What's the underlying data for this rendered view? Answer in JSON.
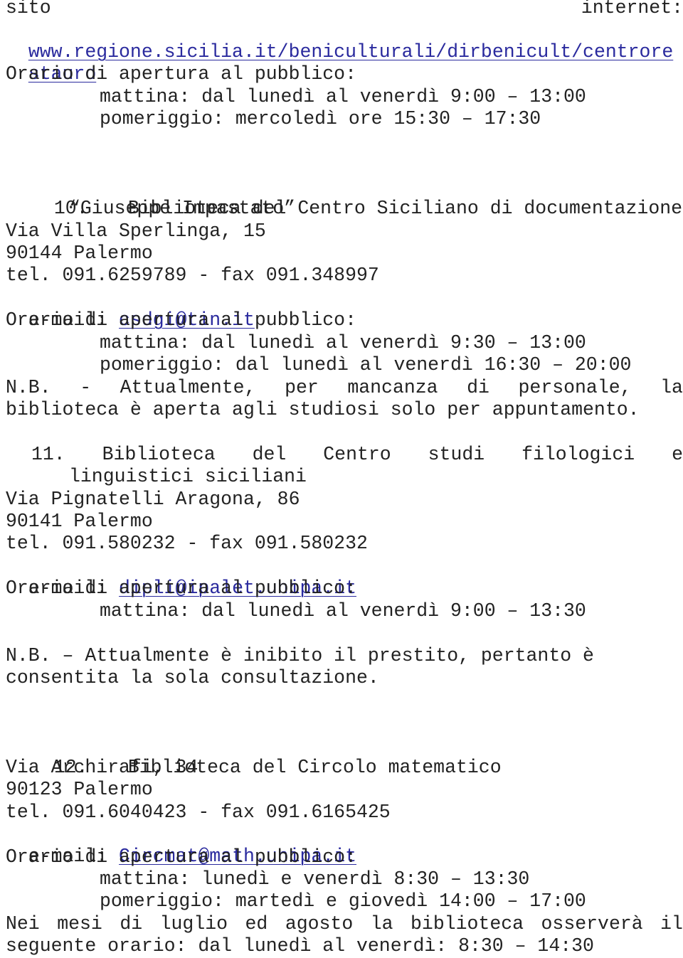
{
  "intro": {
    "site_label_left": "sito",
    "site_label_right": "internet:",
    "url_line1": "www.regione.sicilia.it/beniculturali/dirbenicult/centrore",
    "url_line2": "stauro",
    "hours_heading": "Orario di apertura al pubblico:",
    "hours_morning": "mattina: dal lunedì al venerdì 9:00 – 13:00",
    "hours_afternoon": "pomeriggio: mercoledì ore 15:30 – 17:30"
  },
  "entries": [
    {
      "number": "10.",
      "title_line1": "Biblioteca del Centro Siciliano di documentazione",
      "title_line2": "“Giuseppe Impastato”",
      "address": "Via Villa Sperlinga, 15",
      "city": "90144 Palermo",
      "phone": "tel. 091.6259789 - fax 091.348997",
      "email_label": "e-mail: ",
      "email": "csdgi@tin.it",
      "hours_heading": "Orario di apertura al pubblico:",
      "hours_morning": "mattina: dal lunedì al venerdì 9:30 – 13:00",
      "hours_afternoon": "pomeriggio: dal lunedì al venerdì 16:30 – 20:00",
      "note_line1_words": [
        "N.B.",
        "-",
        "Attualmente,",
        "per",
        "mancanza",
        "di",
        "personale,",
        "la"
      ],
      "note_line2": "biblioteca è aperta agli studiosi solo per appuntamento."
    },
    {
      "number": "11.",
      "title_line1_words": [
        "Biblioteca",
        "del",
        "Centro",
        "studi",
        "filologici",
        "e"
      ],
      "title_line2": "linguistici siciliani",
      "address": "Via Pignatelli Aragona, 86",
      "city": "90141 Palermo",
      "phone": "tel. 091.580232 - fax 091.580232",
      "email_label": "e-mail: ",
      "email": "dipli@ipalet.unipa.it",
      "hours_heading": "Orario di apertura al pubblico:",
      "hours_morning": "mattina: dal lunedì al venerdì 9:00 – 13:30",
      "note_line1": "N.B. – Attualmente è inibito il prestito, pertanto è",
      "note_line2": "consentita la sola consultazione."
    },
    {
      "number": "12.",
      "title_line1": "Biblioteca del Circolo matematico",
      "address": "Via Archirafi, 34",
      "city": "90123 Palermo",
      "phone": "tel. 091.6040423 - fax 091.6165425",
      "email_label": "e-mail: ",
      "email": "Circmat@math.unipa.it",
      "hours_heading": "Orario di apertura al pubblico:",
      "hours_morning": "mattina: lunedì e venerdì 8:30 – 13:30",
      "hours_afternoon": "pomeriggio: martedì e giovedì 14:00 – 17:00",
      "summer_line1_words": [
        "Nei",
        "mesi",
        "di",
        "luglio",
        "ed",
        "agosto",
        "la",
        "biblioteca",
        "osserverà",
        "il"
      ],
      "summer_line2": "seguente orario: dal lunedì al venerdì: 8:30 – 14:30"
    }
  ],
  "colors": {
    "text": "#222222",
    "link": "#2a2a9e"
  }
}
